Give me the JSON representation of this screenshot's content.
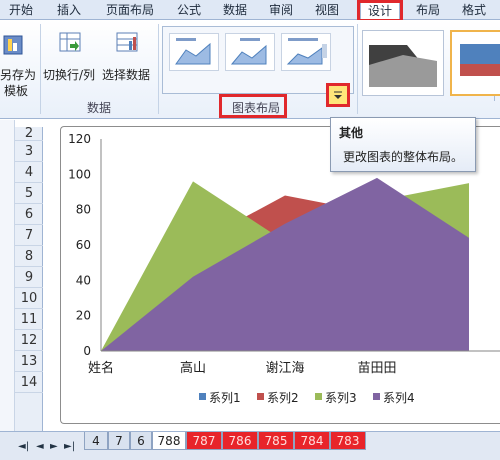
{
  "ribbon_tabs": [
    "开始",
    "插入",
    "页面布局",
    "公式",
    "数据",
    "审阅",
    "视图",
    "设计",
    "布局",
    "格式"
  ],
  "active_tab": "设计",
  "ribbon": {
    "save_template_line1": "另存为",
    "save_template_line2": "模板",
    "switch_row_col": "切换行/列",
    "select_data": "选择数据",
    "data_group_label": "数据",
    "chart_layout_group_label": "图表布局"
  },
  "tooltip": {
    "title": "其他",
    "body": "更改图表的整体布局。"
  },
  "rows": [
    "2",
    "3",
    "4",
    "5",
    "6",
    "7",
    "8",
    "9",
    "10",
    "11",
    "12",
    "13",
    "14"
  ],
  "sheet_tabs": {
    "nav_icons": [
      "first-sheet-icon",
      "prev-sheet-icon",
      "next-sheet-icon",
      "last-sheet-icon"
    ],
    "tabs": [
      "4",
      "7",
      "6",
      "788",
      "787",
      "786",
      "785",
      "784",
      "783"
    ],
    "current": "788",
    "red_tabs": [
      "787",
      "786",
      "785",
      "784",
      "783"
    ]
  },
  "chart_data": {
    "type": "area",
    "categories": [
      "姓名",
      "高山",
      "谢江海",
      "苗田田",
      ""
    ],
    "ylim": [
      0,
      120
    ],
    "yticks": [
      0,
      20,
      40,
      60,
      80,
      100,
      120
    ],
    "series": [
      {
        "name": "系列1",
        "color": "#4f81bd",
        "values": [
          0,
          0,
          0,
          0,
          0
        ]
      },
      {
        "name": "系列2",
        "color": "#c0504d",
        "values": [
          0,
          60,
          88,
          78,
          62
        ]
      },
      {
        "name": "系列3",
        "color": "#9bbb59",
        "values": [
          0,
          96,
          62,
          85,
          95
        ]
      },
      {
        "name": "系列4",
        "color": "#8064a2",
        "values": [
          0,
          42,
          72,
          98,
          64
        ]
      }
    ],
    "legend_position": "bottom"
  }
}
